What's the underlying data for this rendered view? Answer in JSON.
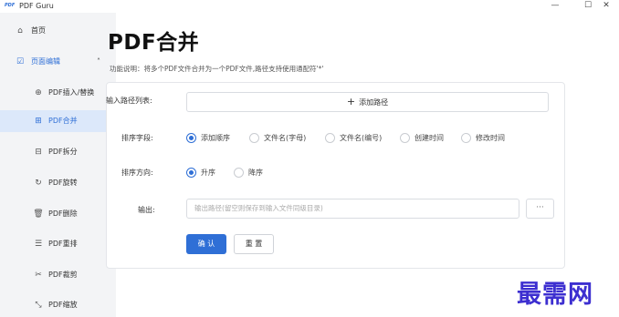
{
  "app": {
    "logo_text": "PDF",
    "title": "PDF Guru",
    "window_controls": {
      "minimize": "—",
      "maximize": "☐",
      "close": "✕"
    }
  },
  "sidebar": {
    "items": [
      {
        "label": "首页",
        "icon": "home-icon",
        "glyph": "⌂"
      },
      {
        "label": "页面编辑",
        "icon": "edit-icon",
        "glyph": "☑",
        "caret": "˄"
      },
      {
        "label": "PDF插入/替换",
        "icon": "insert-icon",
        "glyph": "⊕"
      },
      {
        "label": "PDF合并",
        "icon": "merge-icon",
        "glyph": "⊞"
      },
      {
        "label": "PDF拆分",
        "icon": "split-icon",
        "glyph": "⊟"
      },
      {
        "label": "PDF旋转",
        "icon": "rotate-icon",
        "glyph": "↻"
      },
      {
        "label": "PDF删除",
        "icon": "delete-icon",
        "glyph": "🗑"
      },
      {
        "label": "PDF重排",
        "icon": "reorder-icon",
        "glyph": "☰"
      },
      {
        "label": "PDF裁剪",
        "icon": "crop-icon",
        "glyph": "✂"
      },
      {
        "label": "PDF缩放",
        "icon": "scale-icon",
        "glyph": "⤡"
      }
    ]
  },
  "main": {
    "title": "PDF合并",
    "description": "功能说明：将多个PDF文件合并为一个PDF文件,路径支持使用通配符'*'",
    "input_paths": {
      "label": "输入路径列表:",
      "add_button": "添加路径",
      "add_glyph": "+"
    },
    "sort_field": {
      "label": "排序字段:",
      "options": [
        "添加顺序",
        "文件名(字母)",
        "文件名(编号)",
        "创建时间",
        "修改时间"
      ],
      "selected": "添加顺序"
    },
    "sort_direction": {
      "label": "排序方向:",
      "options": [
        "升序",
        "降序"
      ],
      "selected": "升序"
    },
    "output": {
      "label": "输出:",
      "placeholder": "输出路径(留空则保存到输入文件同级目录)",
      "browse": "···"
    },
    "actions": {
      "confirm": "确 认",
      "reset": "重 置"
    }
  },
  "watermark": "最需网",
  "colors": {
    "accent": "#2f6fd6",
    "sidebar_bg": "#f3f4f6",
    "active_bg": "#dce8fa",
    "watermark": "#3d2fd0"
  }
}
